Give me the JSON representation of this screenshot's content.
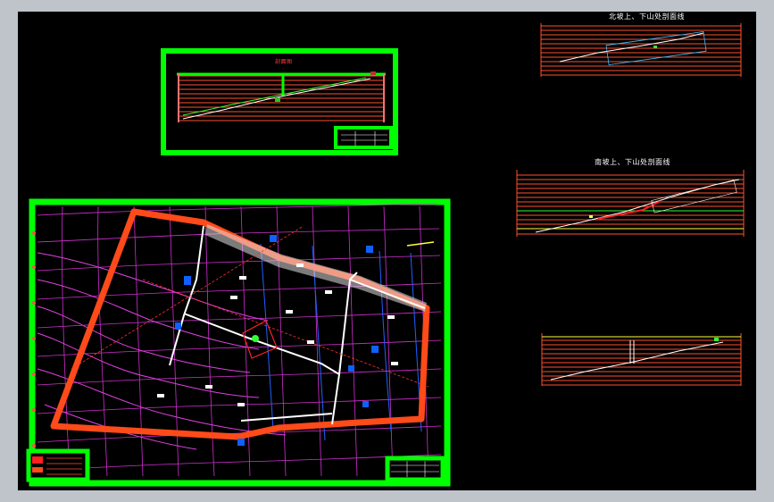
{
  "drawing": {
    "profile_north_title": "北坡上、下山处剖面线",
    "profile_south_title": "南坡上、下山处剖面线",
    "section_sheet_title": "剖面图"
  },
  "colors": {
    "background": "#000000",
    "frame": "#00ff00",
    "boundary": "#ff4a1a",
    "contour": "#e040e0",
    "grid_line": "#ff5030",
    "survey_line": "#ffffff",
    "water_marker": "#1060ff"
  }
}
